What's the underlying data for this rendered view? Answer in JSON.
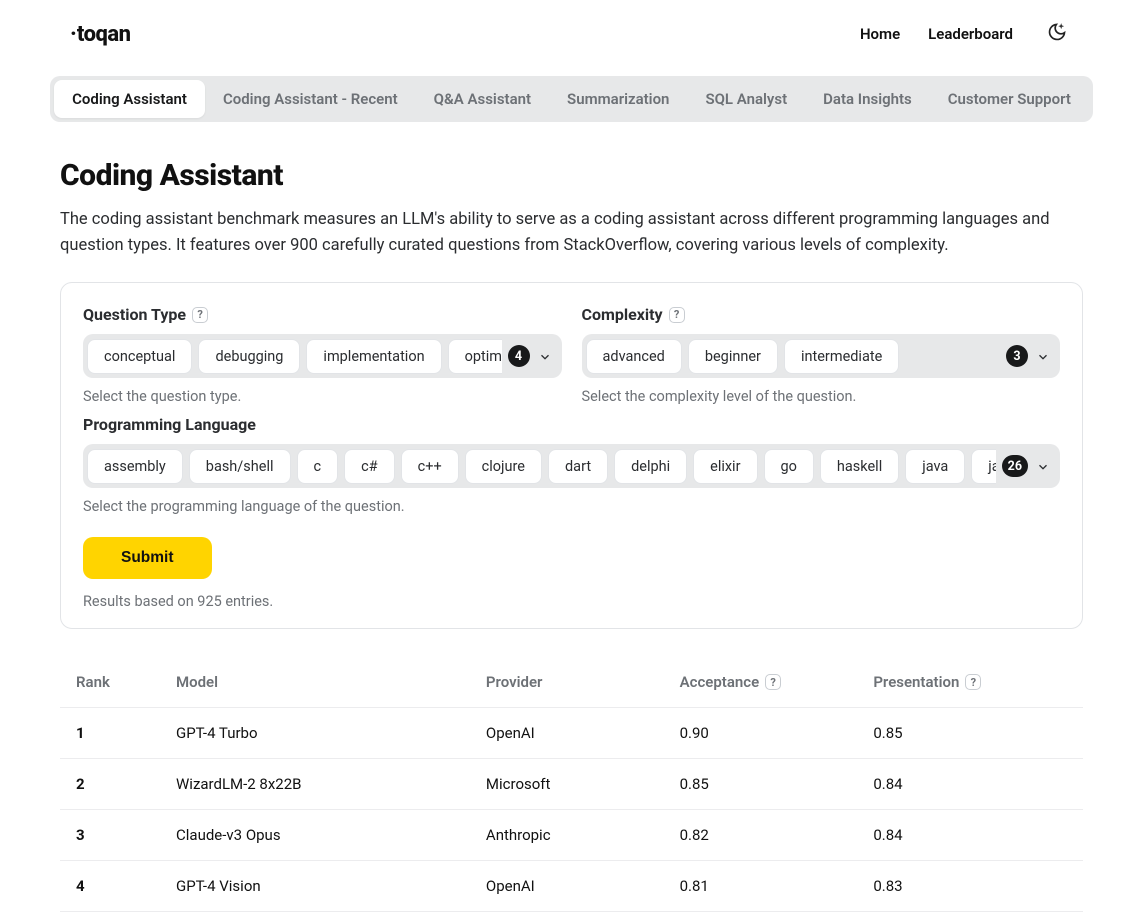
{
  "brand": "toqan",
  "nav": {
    "home": "Home",
    "leaderboard": "Leaderboard"
  },
  "tabs": [
    "Coding Assistant",
    "Coding Assistant - Recent",
    "Q&A Assistant",
    "Summarization",
    "SQL Analyst",
    "Data Insights",
    "Customer Support"
  ],
  "activeTabIndex": 0,
  "page": {
    "title": "Coding Assistant",
    "description": "The coding assistant benchmark measures an LLM's ability to serve as a coding assistant across different programming languages and question types. It features over 900 carefully curated questions from StackOverflow, covering various levels of complexity."
  },
  "filters": {
    "questionType": {
      "label": "Question Type",
      "help": "?",
      "chips": [
        "conceptual",
        "debugging",
        "implementation",
        "optimization"
      ],
      "count": "4",
      "hint": "Select the question type."
    },
    "complexity": {
      "label": "Complexity",
      "help": "?",
      "chips": [
        "advanced",
        "beginner",
        "intermediate"
      ],
      "count": "3",
      "hint": "Select the complexity level of the question."
    },
    "language": {
      "label": "Programming Language",
      "chips": [
        "assembly",
        "bash/shell",
        "c",
        "c#",
        "c++",
        "clojure",
        "dart",
        "delphi",
        "elixir",
        "go",
        "haskell",
        "java",
        "javascript"
      ],
      "count": "26",
      "hint": "Select the programming language of the question."
    }
  },
  "actions": {
    "submit": "Submit",
    "resultsNote": "Results based on 925 entries."
  },
  "table": {
    "headers": {
      "rank": "Rank",
      "model": "Model",
      "provider": "Provider",
      "acceptance": "Acceptance",
      "presentation": "Presentation",
      "help": "?"
    },
    "rows": [
      {
        "rank": "1",
        "model": "GPT-4 Turbo",
        "provider": "OpenAI",
        "acceptance": "0.90",
        "presentation": "0.85"
      },
      {
        "rank": "2",
        "model": "WizardLM-2 8x22B",
        "provider": "Microsoft",
        "acceptance": "0.85",
        "presentation": "0.84"
      },
      {
        "rank": "3",
        "model": "Claude-v3 Opus",
        "provider": "Anthropic",
        "acceptance": "0.82",
        "presentation": "0.84"
      },
      {
        "rank": "4",
        "model": "GPT-4 Vision",
        "provider": "OpenAI",
        "acceptance": "0.81",
        "presentation": "0.83"
      }
    ]
  }
}
